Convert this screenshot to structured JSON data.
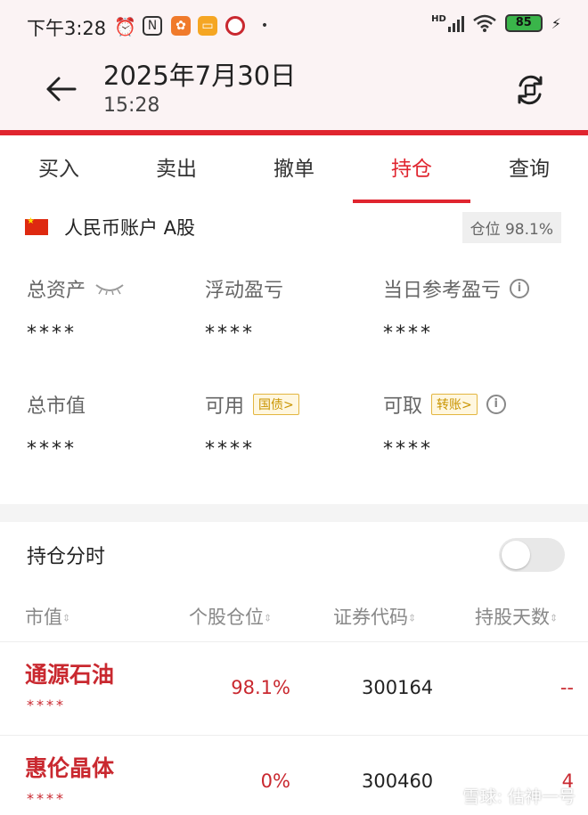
{
  "status_bar": {
    "time": "下午3:28",
    "network_label": "HD",
    "battery_level": "85"
  },
  "header": {
    "title": "2025年7月30日",
    "subtitle": "15:28"
  },
  "tabs": [
    {
      "label": "买入",
      "active": false
    },
    {
      "label": "卖出",
      "active": false
    },
    {
      "label": "撤单",
      "active": false
    },
    {
      "label": "持仓",
      "active": true
    },
    {
      "label": "查询",
      "active": false
    }
  ],
  "account": {
    "name": "人民币账户 A股",
    "position_badge": "仓位 98.1%"
  },
  "summary": {
    "total_assets_label": "总资产",
    "total_assets_value": "****",
    "floating_pl_label": "浮动盈亏",
    "floating_pl_value": "****",
    "daily_pl_label": "当日参考盈亏",
    "daily_pl_value": "****",
    "market_value_label": "总市值",
    "market_value_value": "****",
    "available_label": "可用",
    "available_chip": "国债>",
    "available_value": "****",
    "withdrawable_label": "可取",
    "withdrawable_chip": "转账>",
    "withdrawable_value": "****"
  },
  "intraday": {
    "label": "持仓分时",
    "toggle_on": false
  },
  "table": {
    "headers": [
      "市值",
      "个股仓位",
      "证券代码",
      "持股天数"
    ],
    "rows": [
      {
        "name": "通源石油",
        "value": "****",
        "position": "98.1%",
        "code": "300164",
        "days": "--"
      },
      {
        "name": "惠伦晶体",
        "value": "****",
        "position": "0%",
        "code": "300460",
        "days": "4"
      }
    ]
  },
  "watermark": "雪球: 估神一号",
  "colors": {
    "accent": "#e0252f",
    "stock_red": "#c9282f",
    "chip_gold": "#c99400"
  }
}
